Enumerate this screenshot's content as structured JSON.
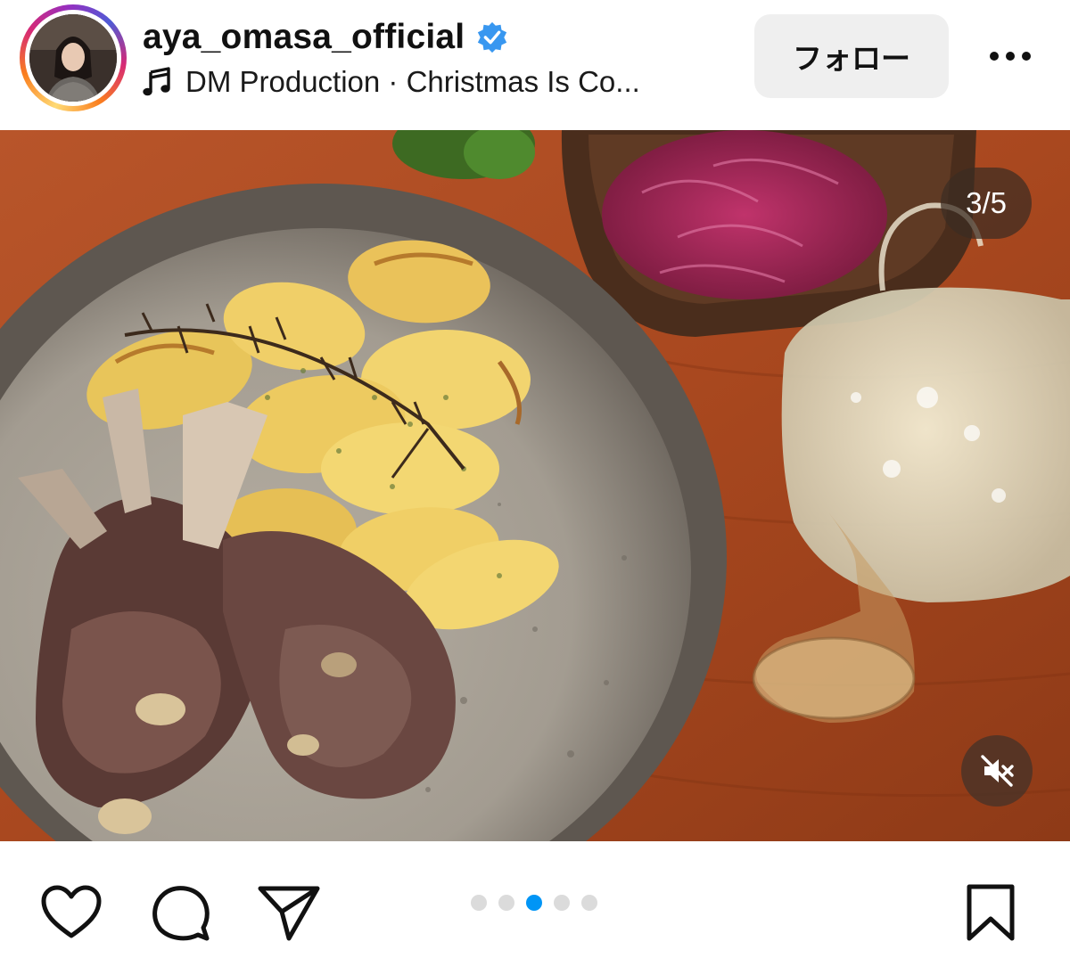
{
  "post": {
    "username": "aya_omasa_official",
    "verified": true,
    "music": "DM Production · Christmas Is Co...",
    "follow_label": "フォロー",
    "more_icon": "more-dots-icon"
  },
  "media": {
    "counter": "3/5",
    "current_index": 3,
    "total": 5,
    "muted": true
  },
  "actions": {
    "icons": [
      "heart-icon",
      "comment-icon",
      "share-icon",
      "bookmark-icon"
    ]
  },
  "colors": {
    "accent_blue": "#0095f6",
    "follow_bg": "#efefef",
    "dot_inactive": "#dbdbdb"
  }
}
